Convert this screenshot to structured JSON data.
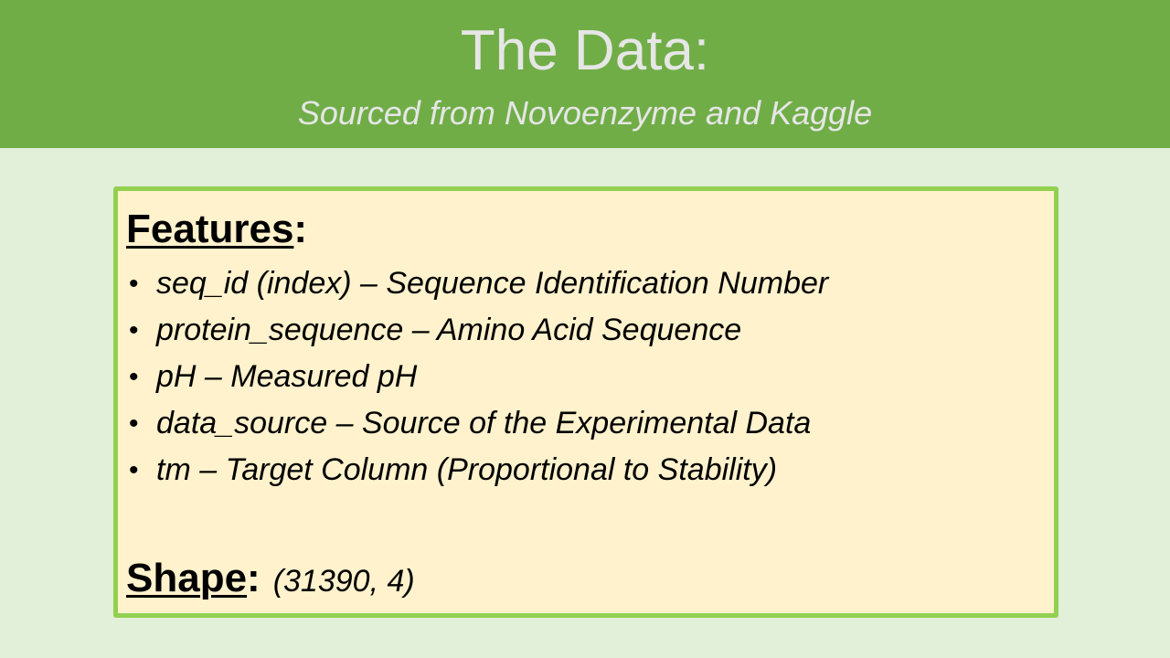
{
  "header": {
    "title": "The Data:",
    "subtitle": "Sourced from Novoenzyme and Kaggle"
  },
  "features": {
    "heading": "Features",
    "colon": ":",
    "bullet_glyph": "•",
    "items": [
      "seq_id (index) – Sequence Identification Number",
      "protein_sequence – Amino Acid Sequence",
      "pH – Measured pH",
      "data_source – Source of the Experimental Data",
      "tm – Target Column (Proportional to Stability)"
    ]
  },
  "shape": {
    "heading": "Shape",
    "colon": ":",
    "value": "(31390, 4)"
  },
  "colors": {
    "header_bg": "#70ad47",
    "page_bg": "#e2efd9",
    "box_bg": "#fff2cc",
    "box_border": "#92d050"
  }
}
